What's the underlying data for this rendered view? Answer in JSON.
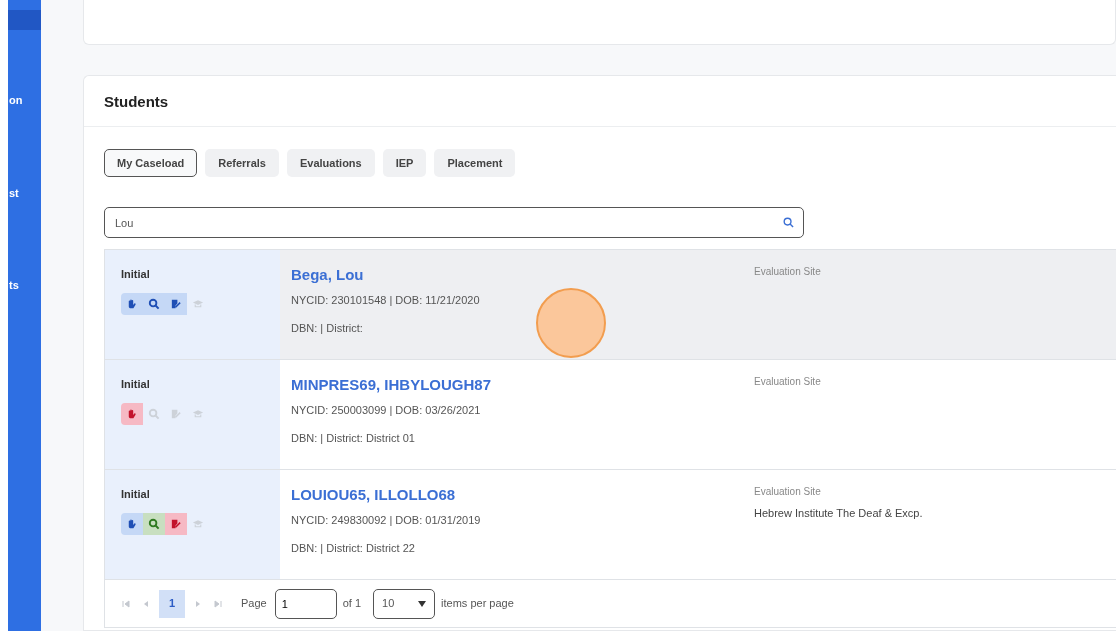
{
  "sidebar": {
    "items": [
      {
        "label": "on"
      },
      {
        "label": "st"
      },
      {
        "label": "ts"
      }
    ]
  },
  "students": {
    "title": "Students",
    "tabs": [
      {
        "label": "My Caseload",
        "selected": true
      },
      {
        "label": "Referrals",
        "selected": false
      },
      {
        "label": "Evaluations",
        "selected": false
      },
      {
        "label": "IEP",
        "selected": false
      },
      {
        "label": "Placement",
        "selected": false
      }
    ],
    "search": {
      "value": "Lou"
    },
    "rows": [
      {
        "status": "Initial",
        "highlighted": true,
        "actions": [
          {
            "kind": "hand",
            "enabled": true,
            "color": "#c5d8f6"
          },
          {
            "kind": "zoom",
            "enabled": true,
            "color": "#c5d8f6"
          },
          {
            "kind": "sign",
            "enabled": true,
            "color": "#c5d8f6"
          },
          {
            "kind": "cap",
            "enabled": false
          }
        ],
        "name": "Bega, Lou",
        "ids": "NYCID: 230101548 | DOB: 11/21/2020",
        "district": "DBN: | District:",
        "site_label": "Evaluation Site"
      },
      {
        "status": "Initial",
        "highlighted": false,
        "actions": [
          {
            "kind": "hand",
            "enabled": true,
            "color": "#f6b9c4"
          },
          {
            "kind": "zoom",
            "enabled": false
          },
          {
            "kind": "sign",
            "enabled": false
          },
          {
            "kind": "cap",
            "enabled": false
          }
        ],
        "name": "MINPRES69, IHBYLOUGH87",
        "ids": "NYCID: 250003099 | DOB: 03/26/2021",
        "district": "DBN: | District: District 01",
        "site_label": "Evaluation Site"
      },
      {
        "status": "Initial",
        "highlighted": false,
        "actions": [
          {
            "kind": "hand",
            "enabled": true,
            "color": "#c5d8f6"
          },
          {
            "kind": "zoom",
            "enabled": true,
            "color": "#c8dfc0"
          },
          {
            "kind": "sign",
            "enabled": true,
            "color": "#f6b9c4"
          },
          {
            "kind": "cap",
            "enabled": false
          }
        ],
        "name": "LOUIOU65, ILLOLLO68",
        "ids": "NYCID: 249830092 | DOB: 01/31/2019",
        "district": "DBN: | District: District 22",
        "site_label": "Evaluation Site",
        "site": "Hebrew Institute The Deaf & Excp."
      }
    ],
    "pager": {
      "current": "1",
      "page_label": "Page",
      "page_value": "1",
      "of": "of 1",
      "size": "10",
      "size_label": "items per page"
    }
  },
  "click_marker": true
}
